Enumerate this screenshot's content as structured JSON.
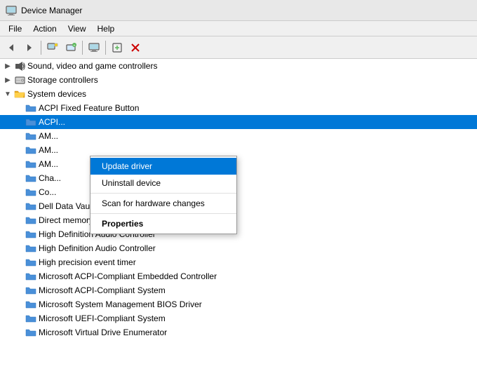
{
  "titleBar": {
    "title": "Device Manager",
    "iconLabel": "device-manager-icon"
  },
  "menuBar": {
    "items": [
      {
        "label": "File",
        "id": "file"
      },
      {
        "label": "Action",
        "id": "action"
      },
      {
        "label": "View",
        "id": "view"
      },
      {
        "label": "Help",
        "id": "help"
      }
    ]
  },
  "toolbar": {
    "buttons": [
      {
        "id": "back",
        "icon": "◀",
        "label": "Back"
      },
      {
        "id": "forward",
        "icon": "▶",
        "label": "Forward"
      },
      {
        "id": "sep1",
        "type": "sep"
      },
      {
        "id": "properties",
        "icon": "🖥",
        "label": "Properties"
      },
      {
        "id": "update",
        "icon": "🔧",
        "label": "Update driver"
      },
      {
        "id": "sep2",
        "type": "sep"
      },
      {
        "id": "computer",
        "icon": "💻",
        "label": "Computer"
      },
      {
        "id": "sep3",
        "type": "sep"
      },
      {
        "id": "add",
        "icon": "📋",
        "label": "Add"
      },
      {
        "id": "remove",
        "icon": "✖",
        "label": "Remove",
        "color": "red"
      }
    ]
  },
  "tree": [
    {
      "id": "sound",
      "level": 0,
      "icon": "🔊",
      "iconType": "speaker",
      "label": "Sound, video and game controllers",
      "toggle": "▶",
      "expanded": false
    },
    {
      "id": "storage",
      "level": 0,
      "icon": "💾",
      "iconType": "hdd",
      "label": "Storage controllers",
      "toggle": "▶",
      "expanded": false
    },
    {
      "id": "system",
      "level": 0,
      "icon": "📁",
      "iconType": "folder-open",
      "label": "System devices",
      "toggle": "▼",
      "expanded": true
    },
    {
      "id": "acpi-fixed",
      "level": 1,
      "icon": "📁",
      "iconType": "folder",
      "label": "ACPI Fixed Feature Button",
      "toggle": "",
      "selected": false
    },
    {
      "id": "acpi-x",
      "level": 1,
      "icon": "📁",
      "iconType": "folder",
      "label": "ACPI...",
      "toggle": "",
      "selected": true
    },
    {
      "id": "am1",
      "level": 1,
      "icon": "📁",
      "iconType": "folder",
      "label": "AM...",
      "toggle": "",
      "selected": false
    },
    {
      "id": "am2",
      "level": 1,
      "icon": "📁",
      "iconType": "folder",
      "label": "AM...",
      "toggle": "",
      "selected": false
    },
    {
      "id": "am3",
      "level": 1,
      "icon": "📁",
      "iconType": "folder",
      "label": "AM...",
      "toggle": "",
      "selected": false
    },
    {
      "id": "cha",
      "level": 1,
      "icon": "📁",
      "iconType": "folder",
      "label": "Cha...",
      "toggle": "",
      "selected": false
    },
    {
      "id": "co",
      "level": 1,
      "icon": "📁",
      "iconType": "folder",
      "label": "Co...",
      "toggle": "",
      "selected": false
    },
    {
      "id": "dell-data",
      "level": 1,
      "icon": "📁",
      "iconType": "folder",
      "label": "Dell Data Vault Control Device",
      "toggle": "",
      "selected": false
    },
    {
      "id": "direct-mem",
      "level": 1,
      "icon": "📁",
      "iconType": "folder",
      "label": "Direct memory access controller",
      "toggle": "",
      "selected": false
    },
    {
      "id": "hda1",
      "level": 1,
      "icon": "📁",
      "iconType": "folder",
      "label": "High Definition Audio Controller",
      "toggle": "",
      "selected": false
    },
    {
      "id": "hda2",
      "level": 1,
      "icon": "📁",
      "iconType": "folder",
      "label": "High Definition Audio Controller",
      "toggle": "",
      "selected": false
    },
    {
      "id": "hpet",
      "level": 1,
      "icon": "📁",
      "iconType": "folder",
      "label": "High precision event timer",
      "toggle": "",
      "selected": false
    },
    {
      "id": "ms-acpi-emb",
      "level": 1,
      "icon": "📁",
      "iconType": "folder",
      "label": "Microsoft ACPI-Compliant Embedded Controller",
      "toggle": "",
      "selected": false
    },
    {
      "id": "ms-acpi-sys",
      "level": 1,
      "icon": "📁",
      "iconType": "folder",
      "label": "Microsoft ACPI-Compliant System",
      "toggle": "",
      "selected": false
    },
    {
      "id": "ms-sys-mgmt",
      "level": 1,
      "icon": "📁",
      "iconType": "folder",
      "label": "Microsoft System Management BIOS Driver",
      "toggle": "",
      "selected": false
    },
    {
      "id": "ms-uefi",
      "level": 1,
      "icon": "📁",
      "iconType": "folder",
      "label": "Microsoft UEFI-Compliant System",
      "toggle": "",
      "selected": false
    },
    {
      "id": "ms-vde",
      "level": 1,
      "icon": "📁",
      "iconType": "folder",
      "label": "Microsoft Virtual Drive Enumerator",
      "toggle": "",
      "selected": false
    }
  ],
  "contextMenu": {
    "visible": true,
    "items": [
      {
        "id": "update-driver",
        "label": "Update driver",
        "highlighted": true,
        "bold": false
      },
      {
        "id": "uninstall-device",
        "label": "Uninstall device",
        "highlighted": false,
        "bold": false
      },
      {
        "id": "sep",
        "type": "sep"
      },
      {
        "id": "scan-hardware",
        "label": "Scan for hardware changes",
        "highlighted": false,
        "bold": false
      },
      {
        "id": "sep2",
        "type": "sep"
      },
      {
        "id": "properties",
        "label": "Properties",
        "highlighted": false,
        "bold": true
      }
    ]
  },
  "colors": {
    "selectedBg": "#0078d7",
    "hoverBg": "#cce8ff",
    "accent": "#0078d7",
    "folderColor": "#e6a817"
  }
}
